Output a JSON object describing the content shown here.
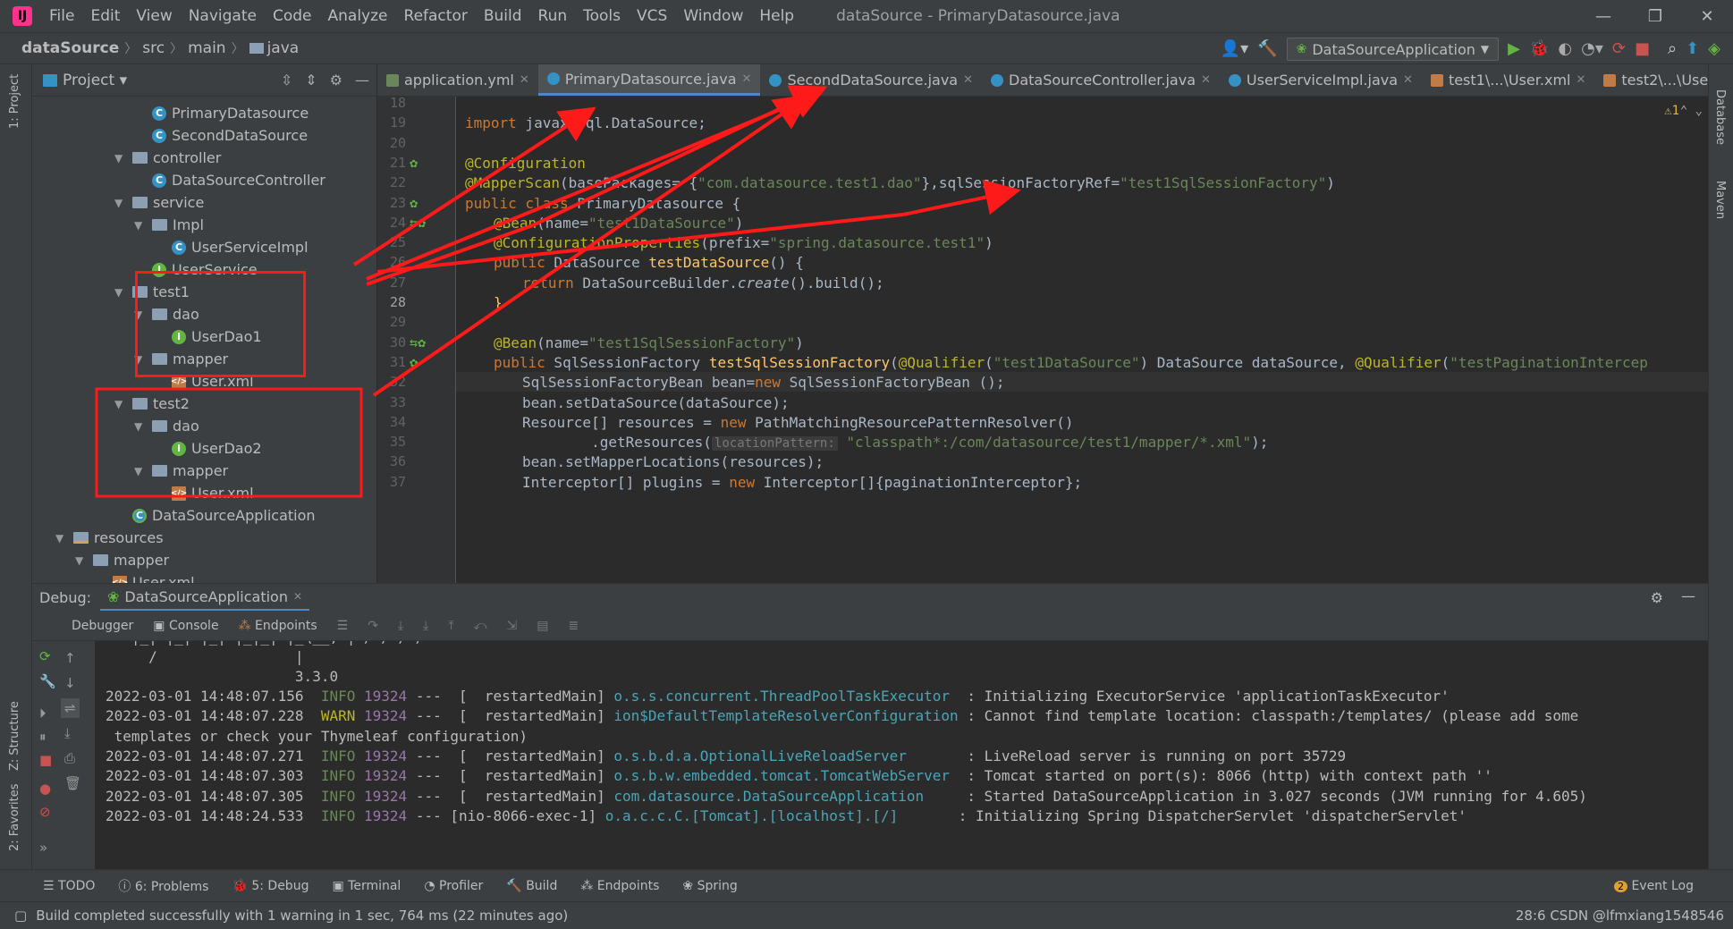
{
  "menu": [
    "File",
    "Edit",
    "View",
    "Navigate",
    "Code",
    "Analyze",
    "Refactor",
    "Build",
    "Run",
    "Tools",
    "VCS",
    "Window",
    "Help"
  ],
  "window_title": "dataSource - PrimaryDatasource.java",
  "breadcrumb": [
    "dataSource",
    "src",
    "main",
    "java"
  ],
  "run_config": "DataSourceApplication",
  "project_panel": {
    "title": "Project"
  },
  "left_strip": {
    "project": "1: Project",
    "structure": "Z: Structure",
    "favorites": "2: Favorites"
  },
  "right_strip": {
    "database": "Database",
    "maven": "Maven"
  },
  "tree": [
    {
      "label": "PrimaryDatasource",
      "icon": "class-icon",
      "depth": 6
    },
    {
      "label": "SecondDataSource",
      "icon": "class-icon",
      "depth": 6
    },
    {
      "label": "controller",
      "icon": "folder-icon",
      "depth": 5,
      "arrow": "⌄"
    },
    {
      "label": "DataSourceController",
      "icon": "class-icon",
      "depth": 6
    },
    {
      "label": "service",
      "icon": "folder-icon",
      "depth": 5,
      "arrow": "⌄"
    },
    {
      "label": "Impl",
      "icon": "folder-icon",
      "depth": 6,
      "arrow": "⌄"
    },
    {
      "label": "UserServiceImpl",
      "icon": "class-icon",
      "depth": 7
    },
    {
      "label": "UserService",
      "icon": "interface-icon",
      "depth": 6
    },
    {
      "label": "test1",
      "icon": "folder-icon",
      "depth": 5,
      "arrow": "⌄"
    },
    {
      "label": "dao",
      "icon": "folder-icon",
      "depth": 6,
      "arrow": "⌄"
    },
    {
      "label": "UserDao1",
      "icon": "interface-icon",
      "depth": 7
    },
    {
      "label": "mapper",
      "icon": "folder-icon",
      "depth": 6,
      "arrow": "⌄"
    },
    {
      "label": "User.xml",
      "icon": "xml-icon",
      "depth": 7
    },
    {
      "label": "test2",
      "icon": "folder-icon",
      "depth": 5,
      "arrow": "⌄"
    },
    {
      "label": "dao",
      "icon": "folder-icon",
      "depth": 6,
      "arrow": "⌄"
    },
    {
      "label": "UserDao2",
      "icon": "interface-icon",
      "depth": 7
    },
    {
      "label": "mapper",
      "icon": "folder-icon",
      "depth": 6,
      "arrow": "⌄"
    },
    {
      "label": "User.xml",
      "icon": "xml-icon",
      "depth": 7
    },
    {
      "label": "DataSourceApplication",
      "icon": "app-icon",
      "depth": 5
    },
    {
      "label": "resources",
      "icon": "resources-icon",
      "depth": 2,
      "arrow": "⌄"
    },
    {
      "label": "mapper",
      "icon": "folder-icon",
      "depth": 3,
      "arrow": "⌄"
    },
    {
      "label": "User.xml",
      "icon": "xml-icon",
      "depth": 4
    }
  ],
  "editor_tabs": [
    {
      "label": "application.yml",
      "kind": "y"
    },
    {
      "label": "PrimaryDatasource.java",
      "kind": "c",
      "active": true
    },
    {
      "label": "SecondDataSource.java",
      "kind": "c"
    },
    {
      "label": "DataSourceController.java",
      "kind": "c"
    },
    {
      "label": "UserServiceImpl.java",
      "kind": "c"
    },
    {
      "label": "test1\\...\\User.xml",
      "kind": "x"
    },
    {
      "label": "test2\\...\\User.xml",
      "kind": "x"
    }
  ],
  "warnings_badge": "⚠1",
  "line_numbers": [
    "18",
    "19",
    "20",
    "21",
    "22",
    "23",
    "24",
    "25",
    "26",
    "27",
    "28",
    "29",
    "30",
    "31",
    "32",
    "33",
    "34",
    "35",
    "36",
    "37"
  ],
  "current_line": "28",
  "code": {
    "l19_kw": "import",
    "l19_rest": " javax.sql.DataSource;",
    "l21": "@Configuration",
    "l22_an": "@MapperScan",
    "l22_a": "(basePackages= {",
    "l22_s1": "\"com.datasource.test1.dao\"",
    "l22_b": "},sqlSessionFactoryRef=",
    "l22_s2": "\"test1SqlSessionFactory\"",
    "l22_c": ")",
    "l23_kw": "public class",
    "l23_rest": " PrimaryDatasource {",
    "l24_an": "@Bean",
    "l24_a": "(name=",
    "l24_s": "\"test1DataSource\"",
    "l24_b": ")",
    "l25_an": "@ConfigurationProperties",
    "l25_a": "(prefix=",
    "l25_s": "\"spring.datasource.test1\"",
    "l25_b": ")",
    "l26_kw": "public",
    "l26_a": " DataSource ",
    "l26_fn": "testDataSource",
    "l26_b": "() {",
    "l27_kw": "return",
    "l27_a": " DataSourceBuilder.",
    "l27_it": "create",
    "l27_b": "().build();",
    "l28": "}",
    "l30_an": "@Bean",
    "l30_a": "(name=",
    "l30_s": "\"test1SqlSessionFactory\"",
    "l30_b": ")",
    "l31_kw": "public",
    "l31_a": " SqlSessionFactory ",
    "l31_fn": "testSqlSessionFactory",
    "l31_b": "(",
    "l31_an1": "@Qualifier",
    "l31_c": "(",
    "l31_s1": "\"test1DataSource\"",
    "l31_d": ") DataSource dataSource, ",
    "l31_an2": "@Qualifier",
    "l31_e": "(",
    "l31_s2": "\"testPaginationIntercep",
    "l32_a": "SqlSessionFactoryBean bean=",
    "l32_kw": "new",
    "l32_b": " SqlSessionFactoryBean ();",
    "l33": "bean.setDataSource(dataSource);",
    "l34_a": "Resource[] resources = ",
    "l34_kw": "new",
    "l34_b": " PathMatchingResourcePatternResolver()",
    "l35_a": "        .getResources(",
    "l35_hint": "locationPattern:",
    "l35_s": " \"classpath*:/com/datasource/test1/mapper/*.xml\"",
    "l35_b": ");",
    "l36": "bean.setMapperLocations(resources);",
    "l37_a": "Interceptor[] plugins = ",
    "l37_kw": "new",
    "l37_b": " Interceptor[]{paginationInterceptor};"
  },
  "debug": {
    "label": "Debug:",
    "session": "DataSourceApplication",
    "subtabs": [
      "Debugger",
      "Console",
      "Endpoints"
    ]
  },
  "console": {
    "banner1": " ' |_| |_| |_| |_|_| |_\\__, | / / / /",
    "banner2": "     /                |",
    "version": "                      3.3.0",
    "lines": [
      {
        "ts": "2022-03-01 14:48:07.156",
        "lvl": "INFO",
        "pid": "19324",
        "thr": "---  [  restartedMain]",
        "lg": "o.s.s.concurrent.ThreadPoolTaskExecutor  ",
        "msg": ": Initializing ExecutorService 'applicationTaskExecutor'"
      },
      {
        "ts": "2022-03-01 14:48:07.228",
        "lvl": "WARN",
        "pid": "19324",
        "thr": "---  [  restartedMain]",
        "lg": "ion$DefaultTemplateResolverConfiguration ",
        "msg": ": Cannot find template location: classpath:/templates/ (please add some"
      },
      {
        "ts": "",
        "lvl": "",
        "pid": "",
        "thr": "",
        "lg": "",
        "msg": " templates or check your Thymeleaf configuration)"
      },
      {
        "ts": "2022-03-01 14:48:07.271",
        "lvl": "INFO",
        "pid": "19324",
        "thr": "---  [  restartedMain]",
        "lg": "o.s.b.d.a.OptionalLiveReloadServer       ",
        "msg": ": LiveReload server is running on port 35729"
      },
      {
        "ts": "2022-03-01 14:48:07.303",
        "lvl": "INFO",
        "pid": "19324",
        "thr": "---  [  restartedMain]",
        "lg": "o.s.b.w.embedded.tomcat.TomcatWebServer  ",
        "msg": ": Tomcat started on port(s): 8066 (http) with context path ''"
      },
      {
        "ts": "2022-03-01 14:48:07.305",
        "lvl": "INFO",
        "pid": "19324",
        "thr": "---  [  restartedMain]",
        "lg": "com.datasource.DataSourceApplication     ",
        "msg": ": Started DataSourceApplication in 3.027 seconds (JVM running for 4.605)"
      },
      {
        "ts": "2022-03-01 14:48:24.533",
        "lvl": "INFO",
        "pid": "19324",
        "thr": "--- [nio-8066-exec-1]",
        "lg": "o.a.c.c.C.[Tomcat].[localhost].[/]       ",
        "msg": ": Initializing Spring DispatcherServlet 'dispatcherServlet'"
      }
    ]
  },
  "toolwindows": [
    "TODO",
    "6: Problems",
    "5: Debug",
    "Terminal",
    "Profiler",
    "Build",
    "Endpoints",
    "Spring"
  ],
  "event_log": "Event Log",
  "event_count": "2",
  "status": "Build completed successfully with 1 warning in 1 sec, 764 ms (22 minutes ago)",
  "status_right": "28:6  CSDN @lfmxiang1548546",
  "colors": {
    "annotation": "#ff1a1a",
    "accent": "#4a88c7"
  }
}
